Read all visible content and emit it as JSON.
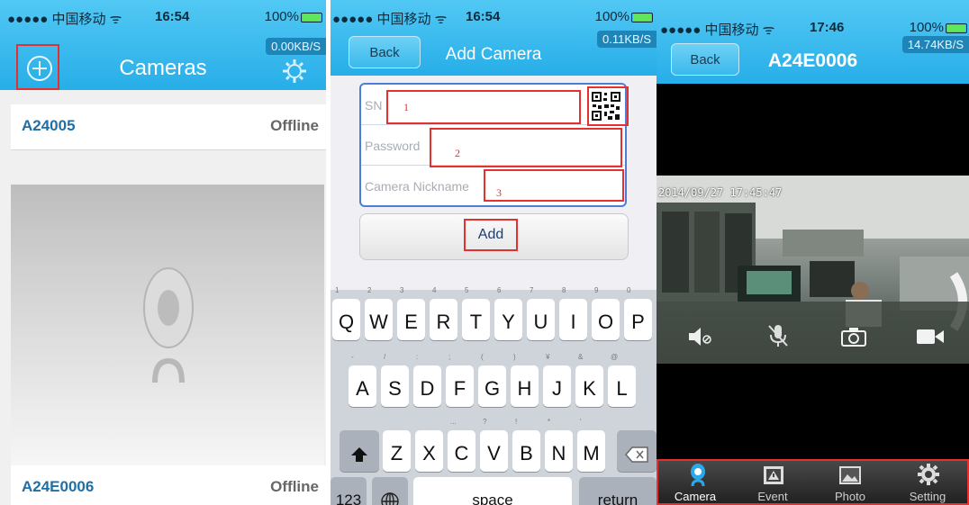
{
  "panels": {
    "list": {
      "status": {
        "carrier": "●●●●● 中国移动 ᯤ",
        "time": "16:54",
        "battery": "100%"
      },
      "speed": "0.00KB/S",
      "title": "Cameras",
      "cameras": [
        {
          "name": "A24005",
          "status": "Offline"
        },
        {
          "name": "A24E0006",
          "status": "Offline"
        }
      ]
    },
    "add": {
      "status": {
        "carrier": "●●●●● 中国移动 ᯤ",
        "time": "16:54",
        "battery": "100%"
      },
      "speed": "0.11KB/S",
      "back_label": "Back",
      "title": "Add Camera",
      "fields": {
        "sn_placeholder": "SN",
        "password_placeholder": "Password",
        "nickname_placeholder": "Camera Nickname"
      },
      "annotations": [
        "1",
        "2",
        "3"
      ],
      "add_label": "Add",
      "keyboard": {
        "row1": [
          [
            "Q",
            "1"
          ],
          [
            "W",
            "2"
          ],
          [
            "E",
            "3"
          ],
          [
            "R",
            "4"
          ],
          [
            "T",
            "5"
          ],
          [
            "Y",
            "6"
          ],
          [
            "U",
            "7"
          ],
          [
            "I",
            "8"
          ],
          [
            "O",
            "9"
          ],
          [
            "P",
            "0"
          ]
        ],
        "row2": [
          [
            "A",
            "-"
          ],
          [
            "S",
            "/"
          ],
          [
            "D",
            ":"
          ],
          [
            "F",
            ";"
          ],
          [
            "G",
            "("
          ],
          [
            "H",
            ")"
          ],
          [
            "J",
            "¥"
          ],
          [
            "K",
            "&"
          ],
          [
            "L",
            "@"
          ]
        ],
        "row3": [
          [
            "Z",
            ""
          ],
          [
            "X",
            ""
          ],
          [
            "C",
            "..."
          ],
          [
            "V",
            "?"
          ],
          [
            "B",
            "!"
          ],
          [
            "N",
            "*"
          ],
          [
            "M",
            "'"
          ]
        ],
        "numbers_label": "123",
        "space_label": "space",
        "return_label": "return"
      }
    },
    "live": {
      "status": {
        "carrier": "●●●●● 中国移动 ᯤ",
        "time": "17:46",
        "battery": "100%"
      },
      "speed": "14.74KB/S",
      "back_label": "Back",
      "title": "A24E0006",
      "timestamp": "2014/09/27  17:45:47",
      "tabs": [
        {
          "label": "Camera",
          "icon": "camera-pin-icon",
          "active": true
        },
        {
          "label": "Event",
          "icon": "event-icon",
          "active": false
        },
        {
          "label": "Photo",
          "icon": "photo-icon",
          "active": false
        },
        {
          "label": "Setting",
          "icon": "gear-icon",
          "active": false
        }
      ]
    }
  },
  "colors": {
    "nav_blue": "#27aee8",
    "highlight_red": "#e53030",
    "link_blue": "#1f6fa6"
  }
}
